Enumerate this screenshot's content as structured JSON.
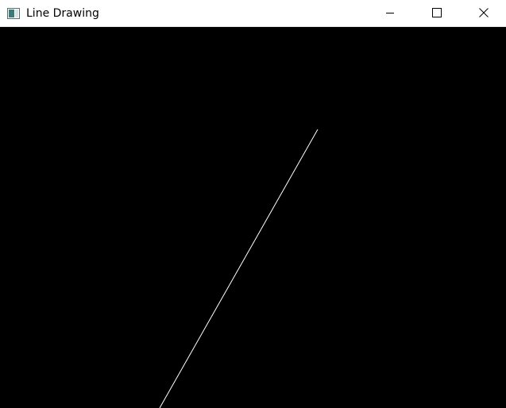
{
  "window": {
    "title": "Line Drawing",
    "app_icon": "window-app-icon",
    "controls": [
      {
        "name": "minimize-button",
        "icon": "minimize-icon"
      },
      {
        "name": "maximize-button",
        "icon": "maximize-icon"
      },
      {
        "name": "close-button",
        "icon": "close-icon"
      }
    ]
  },
  "canvas": {
    "background_color": "#000000",
    "line_color": "#ffffff"
  },
  "colors": {
    "titlebar_bg": "#ffffff",
    "title_text": "#000000",
    "close_hover": "#e81123"
  }
}
